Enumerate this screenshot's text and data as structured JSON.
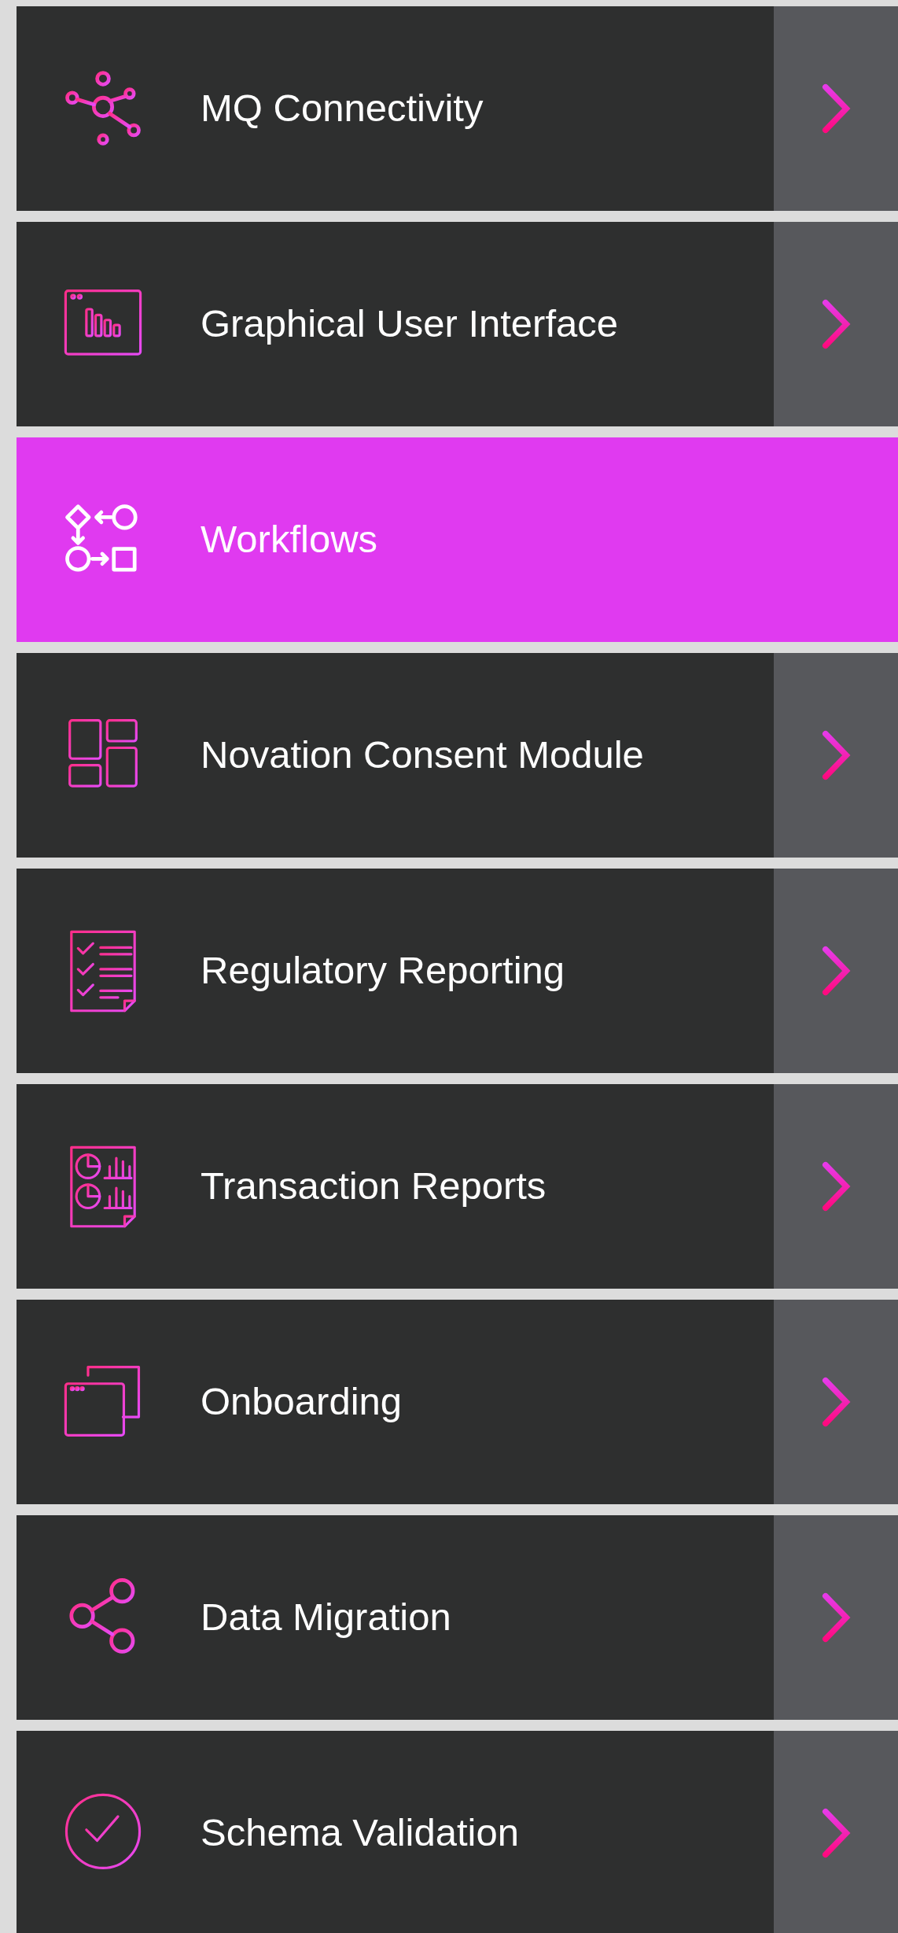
{
  "menu": [
    {
      "label": "MQ Connectivity",
      "selected": false,
      "kind": "network"
    },
    {
      "label": "Graphical User Interface",
      "selected": false,
      "kind": "chart-window"
    },
    {
      "label": "Workflows",
      "selected": true,
      "kind": "flow"
    },
    {
      "label": "Novation Consent Module",
      "selected": false,
      "kind": "tiles"
    },
    {
      "label": "Regulatory Reporting",
      "selected": false,
      "kind": "checklist"
    },
    {
      "label": "Transaction Reports",
      "selected": false,
      "kind": "report"
    },
    {
      "label": "Onboarding",
      "selected": false,
      "kind": "windows"
    },
    {
      "label": "Data Migration",
      "selected": false,
      "kind": "share"
    },
    {
      "label": "Schema Validation",
      "selected": false,
      "kind": "check-circle"
    }
  ]
}
